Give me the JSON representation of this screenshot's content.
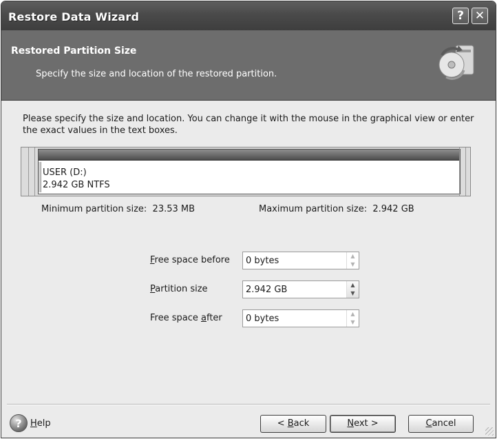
{
  "window": {
    "title": "Restore Data Wizard",
    "help_glyph": "?",
    "close_glyph": "✕"
  },
  "header": {
    "title": "Restored Partition Size",
    "subtitle": "Specify the size and location of the restored partition.",
    "icon": "restore-disk-icon"
  },
  "instruction": "Please specify the size and location. You can change it with the mouse in the graphical view or enter the exact values in the text boxes.",
  "partition": {
    "name": "USER (D:)",
    "size_fs": "2.942 GB  NTFS",
    "fill_fraction": 1.0
  },
  "limits": {
    "min_label": "Minimum partition size:",
    "min_value": "23.53 MB",
    "max_label": "Maximum partition size:",
    "max_value": "2.942 GB"
  },
  "fields": {
    "free_before": {
      "label_mn": "F",
      "label_rest": "ree space before",
      "value": "0 bytes"
    },
    "partition_size": {
      "label_mn": "P",
      "label_rest": "artition size",
      "value": "2.942 GB"
    },
    "free_after": {
      "label_pre": "Free space ",
      "label_mn": "a",
      "label_rest": "fter",
      "value": "0 bytes"
    }
  },
  "footer": {
    "help_mn": "H",
    "help_rest": "elp",
    "back_pre": "< ",
    "back_mn": "B",
    "back_rest": "ack",
    "next_mn": "N",
    "next_rest": "ext >",
    "cancel_mn": "C",
    "cancel_rest": "ancel"
  },
  "colors": {
    "title_bar": "#4a4a4a",
    "header_band": "#6d6d6d",
    "dialog_bg": "#ebebeb"
  }
}
